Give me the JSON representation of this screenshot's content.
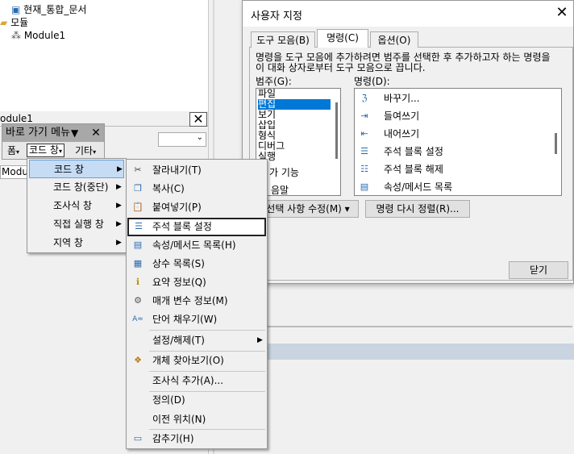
{
  "tree": {
    "items": [
      "현재_통합_문서",
      "모듈",
      "Module1"
    ]
  },
  "props": {
    "title": "odule1",
    "close": "✕",
    "tab": "Modul"
  },
  "toolbar": {
    "title": "바로 가기 메뉴",
    "buttons": [
      "폼",
      "코드 창",
      "기타"
    ]
  },
  "dialog": {
    "title": "사용자 지정",
    "tabs": [
      "도구 모음(B)",
      "명령(C)",
      "옵션(O)"
    ],
    "description": "명령을 도구 모음에 추가하려면 범주를 선택한 후 추가하고자 하는 명령을 이 대화 상자로부터 도구 모음으로 끕니다.",
    "categories_label": "범주(G):",
    "commands_label": "명령(D):",
    "categories": [
      "파일",
      "편집",
      "보기",
      "삽입",
      "형식",
      "디버그",
      "실행",
      "구",
      "가 기능",
      "음말"
    ],
    "selected_category": "편집",
    "commands": [
      {
        "icon": "find-replace-icon",
        "glyph": "ℨ",
        "label": "바꾸기..."
      },
      {
        "icon": "indent-icon",
        "glyph": "⇥",
        "label": "들여쓰기"
      },
      {
        "icon": "outdent-icon",
        "glyph": "⇤",
        "label": "내어쓰기"
      },
      {
        "icon": "comment-block-icon",
        "glyph": "☰",
        "label": "주석 블록 설정"
      },
      {
        "icon": "uncomment-block-icon",
        "glyph": "☷",
        "label": "주석 블록 해제"
      },
      {
        "icon": "list-properties-icon",
        "glyph": "▤",
        "label": "속성/메서드 목록"
      }
    ],
    "modify_button": "선택 사항 수정(M) ▾",
    "rearrange_button": "명령 다시 정렬(R)...",
    "close_button": "닫기"
  },
  "menu1": {
    "items": [
      {
        "label": "코드 창",
        "arrow": "▶"
      },
      {
        "label": "코드 창(중단)",
        "arrow": "▶"
      },
      {
        "label": "조사식 창",
        "arrow": "▶"
      },
      {
        "label": "직접 실행 창",
        "arrow": "▶"
      },
      {
        "label": "지역 창",
        "arrow": "▶"
      }
    ]
  },
  "menu2": {
    "items": [
      {
        "icon": "cut-icon",
        "glyph": "✂",
        "label": "잘라내기(T)"
      },
      {
        "icon": "copy-icon",
        "glyph": "❐",
        "label": "복사(C)"
      },
      {
        "icon": "paste-icon",
        "glyph": "📋",
        "label": "붙여넣기(P)"
      },
      {
        "icon": "comment-block-icon",
        "glyph": "☰",
        "label": "주석 블록 설정"
      },
      {
        "icon": "list-properties-icon",
        "glyph": "▤",
        "label": "속성/메서드 목록(H)"
      },
      {
        "icon": "list-constants-icon",
        "glyph": "▦",
        "label": "상수 목록(S)"
      },
      {
        "icon": "quick-info-icon",
        "glyph": "ℹ",
        "label": "요약 정보(Q)"
      },
      {
        "icon": "parameter-info-icon",
        "glyph": "⚙",
        "label": "매개 변수 정보(M)"
      },
      {
        "icon": "complete-word-icon",
        "glyph": "A≈",
        "label": "단어 채우기(W)"
      },
      {
        "icon": "",
        "glyph": "",
        "label": "설정/해제(T)",
        "arrow": "▶"
      },
      {
        "icon": "object-browser-icon",
        "glyph": "❖",
        "label": "개체 찾아보기(O)"
      },
      {
        "icon": "",
        "glyph": "",
        "label": "조사식 추가(A)..."
      },
      {
        "icon": "",
        "glyph": "",
        "label": "정의(D)"
      },
      {
        "icon": "",
        "glyph": "",
        "label": "이전 위치(N)"
      },
      {
        "icon": "hide-icon",
        "glyph": "▭",
        "label": "감추기(H)"
      }
    ]
  },
  "colors": {
    "selection": "#c5dcf4",
    "category_selected": "#0078d7",
    "toolbar_title": "#a8a8a8"
  }
}
